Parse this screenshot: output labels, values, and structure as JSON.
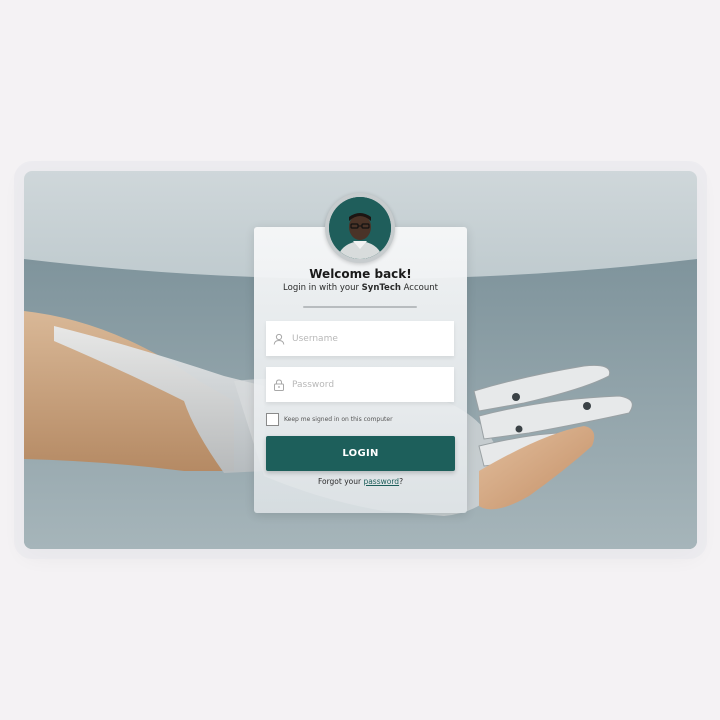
{
  "login_card": {
    "welcome_title": "Welcome back!",
    "subtitle_prefix": "Login in with your ",
    "brand_name": "SynTech",
    "subtitle_suffix": " Account",
    "username": {
      "value": "",
      "placeholder": "Username"
    },
    "password": {
      "value": "",
      "placeholder": "Password"
    },
    "remember_label": "Keep me signed in on this computer",
    "remember_checked": false,
    "login_button_label": "LOGIN",
    "forgot_prefix": "Forgot your ",
    "forgot_link_label": "password",
    "forgot_suffix": "?"
  },
  "icons": {
    "username": "user-icon",
    "password": "lock-icon"
  },
  "colors": {
    "accent": "#1d5f5b",
    "page_background": "#f4f2f4",
    "card_background": "#f3f5f6"
  }
}
